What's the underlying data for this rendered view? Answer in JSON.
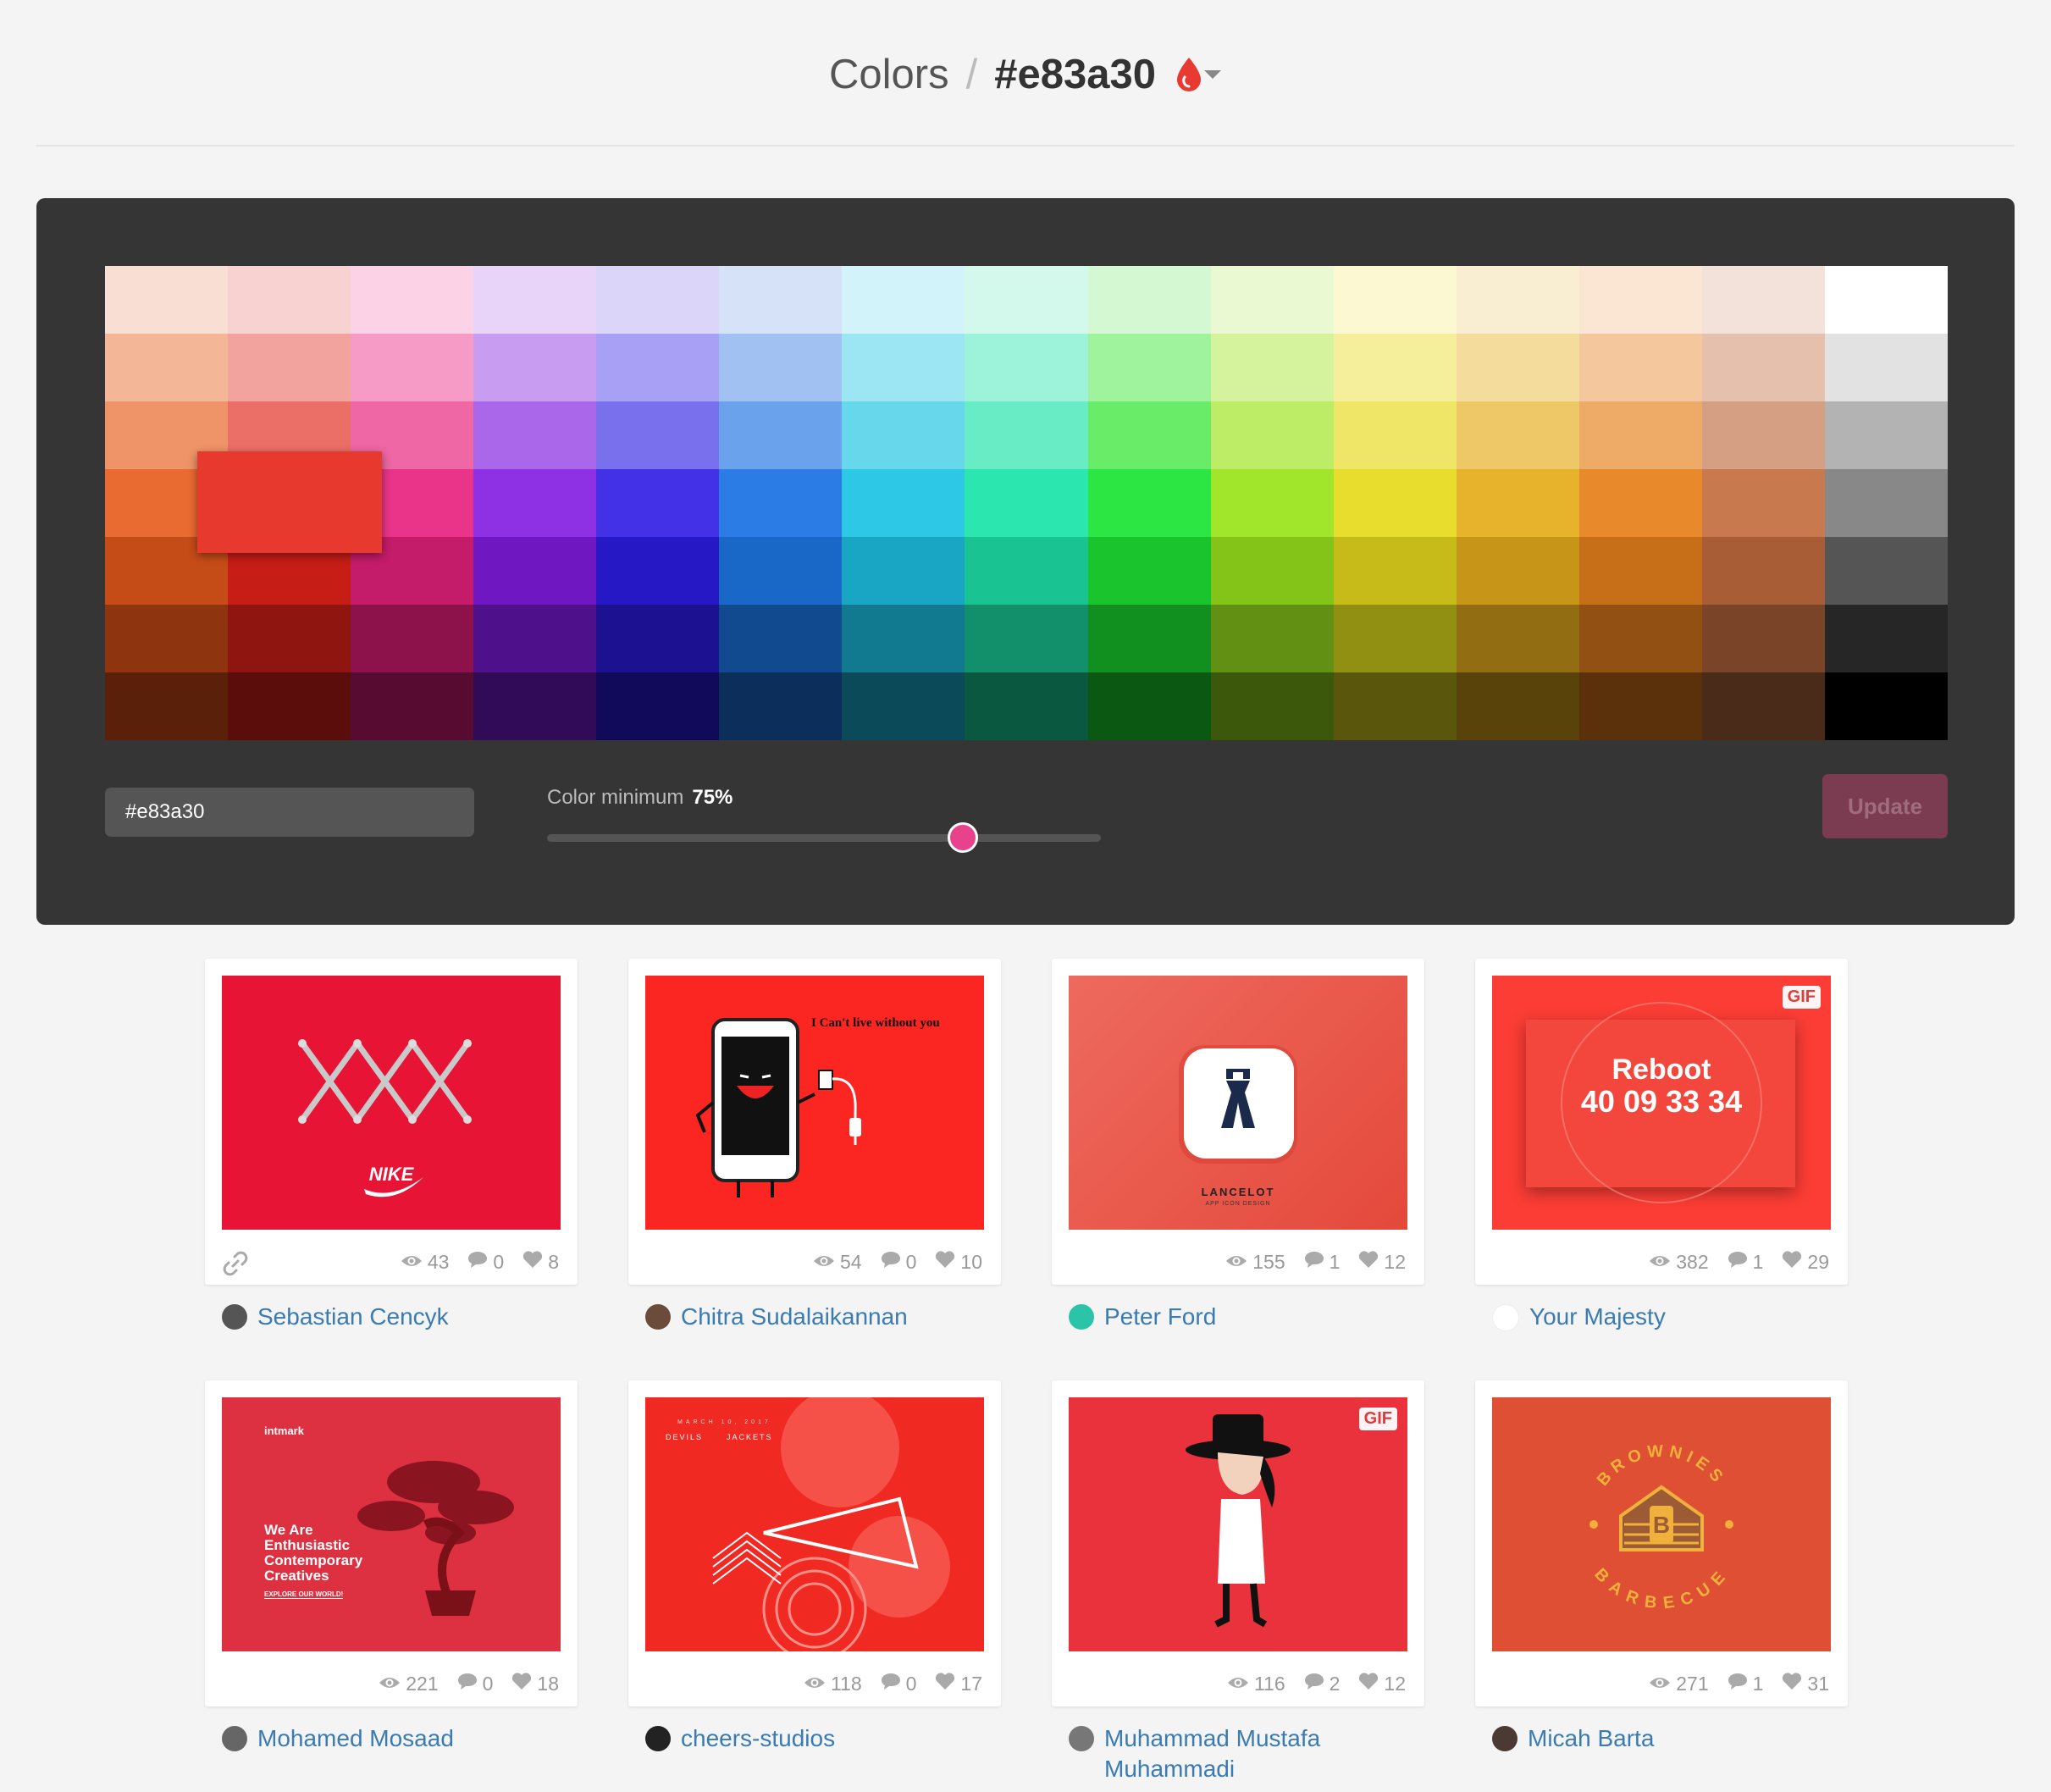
{
  "header": {
    "section": "Colors",
    "separator": "/",
    "current_color": "#e83a30"
  },
  "palette": {
    "columns": [
      [
        "#f9ded3",
        "#f3b797",
        "#ef9468",
        "#e96b31",
        "#c64c17",
        "#8e340f",
        "#5b200a"
      ],
      [
        "#f8d2d0",
        "#f2a39d",
        "#ec6f67",
        "#e84a42",
        "#c61d17",
        "#8e1510",
        "#5a0d0a"
      ],
      [
        "#fbd2e6",
        "#f59bc6",
        "#ef67a5",
        "#e9348a",
        "#c41b6a",
        "#8d124c",
        "#580b30"
      ],
      [
        "#e8d4f8",
        "#c89df1",
        "#aa67ea",
        "#8e30e3",
        "#6f18c2",
        "#4e108b",
        "#310a58"
      ],
      [
        "#dbd5f9",
        "#a8a0f4",
        "#7970ee",
        "#4331e8",
        "#2618c5",
        "#1c1190",
        "#110a5a"
      ],
      [
        "#d6e2f8",
        "#a0c1f2",
        "#6aa2ec",
        "#2c7ce6",
        "#1967c6",
        "#124a90",
        "#0b2e5a"
      ],
      [
        "#d2f3f9",
        "#9ce6f3",
        "#67d8ec",
        "#2cc8e6",
        "#19a6c4",
        "#127a90",
        "#0b4a58"
      ],
      [
        "#d2f9ec",
        "#9cf3da",
        "#67ecc6",
        "#2ce6b0",
        "#19c492",
        "#12906b",
        "#0b5840"
      ],
      [
        "#d4f9d2",
        "#9ef39c",
        "#69ec67",
        "#2ce644",
        "#19c42c",
        "#12901f",
        "#0b5812"
      ],
      [
        "#eaf9d2",
        "#d4f39c",
        "#bdec67",
        "#a2e62c",
        "#84c419",
        "#619012",
        "#3b580b"
      ],
      [
        "#fbf8d2",
        "#f5ef9c",
        "#efe667",
        "#e8dc2c",
        "#c7bb19",
        "#929012",
        "#5a560b"
      ],
      [
        "#faeed2",
        "#f4dc9c",
        "#eec867",
        "#e8b32c",
        "#c79619",
        "#926d12",
        "#5a430b"
      ],
      [
        "#fae6d2",
        "#f4c89c",
        "#eeaa67",
        "#e8892c",
        "#c76e19",
        "#925012",
        "#5a310b"
      ],
      [
        "#f3e2da",
        "#e4c0ad",
        "#d59f83",
        "#c8794d",
        "#a85d37",
        "#7a4428",
        "#4a2a19"
      ],
      [
        "#ffffff",
        "#e2e2e2",
        "#b3b3b3",
        "#888888",
        "#555555",
        "#262626",
        "#000000"
      ]
    ],
    "selected_color": "#e8392f"
  },
  "controls": {
    "hex_value": "#e83a30",
    "slider_label": "Color minimum",
    "slider_value_text": "75%",
    "slider_value": 0.75,
    "update_label": "Update"
  },
  "shots": [
    {
      "views": "43",
      "comments": "0",
      "likes": "8",
      "author": "Sebastian Cencyk",
      "has_link": true
    },
    {
      "views": "54",
      "comments": "0",
      "likes": "10",
      "author": "Chitra Sudalaikannan",
      "caption": "I Can't live without you"
    },
    {
      "views": "155",
      "comments": "1",
      "likes": "12",
      "author": "Peter Ford",
      "caption": "LANCELOT",
      "subcaption": "APP ICON DESIGN"
    },
    {
      "views": "382",
      "comments": "1",
      "likes": "29",
      "author": "Your Majesty",
      "gif": "GIF",
      "title": "Reboot",
      "counter": "40 09 33 34"
    },
    {
      "views": "221",
      "comments": "0",
      "likes": "18",
      "author": "Mohamed Mosaad",
      "caption": "We Are Enthusiastic Contemporary Creatives",
      "logo": "intmark",
      "cta": "EXPLORE OUR WORLD!"
    },
    {
      "views": "118",
      "comments": "0",
      "likes": "17",
      "author": "cheers-studios",
      "date": "MARCH 10, 2017",
      "left": "DEVILS",
      "right": "JACKETS"
    },
    {
      "views": "116",
      "comments": "2",
      "likes": "12",
      "author": "Muhammad Mustafa Muhammadi",
      "gif": "GIF"
    },
    {
      "views": "271",
      "comments": "1",
      "likes": "31",
      "author": "Micah Barta",
      "top": "BROWNIES",
      "bottom": "BARBECUE",
      "mark": "B"
    }
  ]
}
